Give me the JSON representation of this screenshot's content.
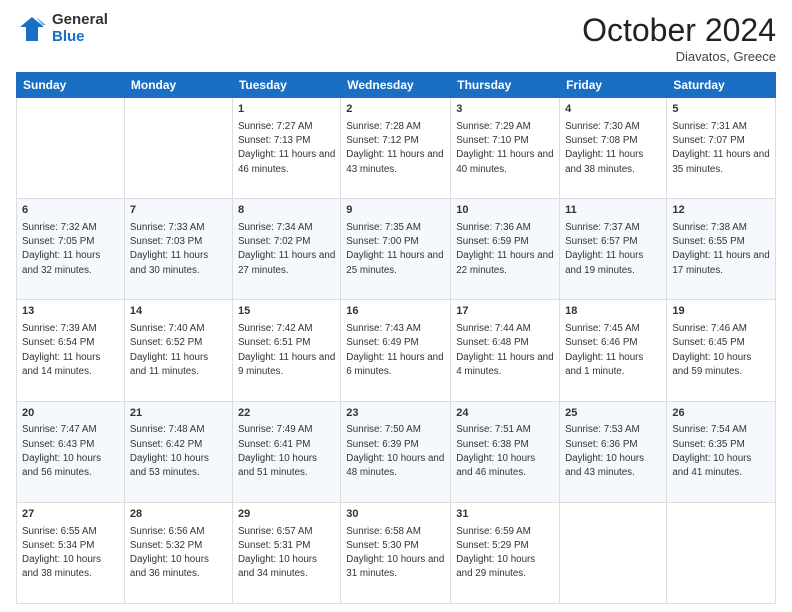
{
  "logo": {
    "general": "General",
    "blue": "Blue"
  },
  "header": {
    "month": "October 2024",
    "location": "Diavatos, Greece"
  },
  "weekdays": [
    "Sunday",
    "Monday",
    "Tuesday",
    "Wednesday",
    "Thursday",
    "Friday",
    "Saturday"
  ],
  "weeks": [
    [
      {
        "day": "",
        "info": ""
      },
      {
        "day": "",
        "info": ""
      },
      {
        "day": "1",
        "info": "Sunrise: 7:27 AM\nSunset: 7:13 PM\nDaylight: 11 hours and 46 minutes."
      },
      {
        "day": "2",
        "info": "Sunrise: 7:28 AM\nSunset: 7:12 PM\nDaylight: 11 hours and 43 minutes."
      },
      {
        "day": "3",
        "info": "Sunrise: 7:29 AM\nSunset: 7:10 PM\nDaylight: 11 hours and 40 minutes."
      },
      {
        "day": "4",
        "info": "Sunrise: 7:30 AM\nSunset: 7:08 PM\nDaylight: 11 hours and 38 minutes."
      },
      {
        "day": "5",
        "info": "Sunrise: 7:31 AM\nSunset: 7:07 PM\nDaylight: 11 hours and 35 minutes."
      }
    ],
    [
      {
        "day": "6",
        "info": "Sunrise: 7:32 AM\nSunset: 7:05 PM\nDaylight: 11 hours and 32 minutes."
      },
      {
        "day": "7",
        "info": "Sunrise: 7:33 AM\nSunset: 7:03 PM\nDaylight: 11 hours and 30 minutes."
      },
      {
        "day": "8",
        "info": "Sunrise: 7:34 AM\nSunset: 7:02 PM\nDaylight: 11 hours and 27 minutes."
      },
      {
        "day": "9",
        "info": "Sunrise: 7:35 AM\nSunset: 7:00 PM\nDaylight: 11 hours and 25 minutes."
      },
      {
        "day": "10",
        "info": "Sunrise: 7:36 AM\nSunset: 6:59 PM\nDaylight: 11 hours and 22 minutes."
      },
      {
        "day": "11",
        "info": "Sunrise: 7:37 AM\nSunset: 6:57 PM\nDaylight: 11 hours and 19 minutes."
      },
      {
        "day": "12",
        "info": "Sunrise: 7:38 AM\nSunset: 6:55 PM\nDaylight: 11 hours and 17 minutes."
      }
    ],
    [
      {
        "day": "13",
        "info": "Sunrise: 7:39 AM\nSunset: 6:54 PM\nDaylight: 11 hours and 14 minutes."
      },
      {
        "day": "14",
        "info": "Sunrise: 7:40 AM\nSunset: 6:52 PM\nDaylight: 11 hours and 11 minutes."
      },
      {
        "day": "15",
        "info": "Sunrise: 7:42 AM\nSunset: 6:51 PM\nDaylight: 11 hours and 9 minutes."
      },
      {
        "day": "16",
        "info": "Sunrise: 7:43 AM\nSunset: 6:49 PM\nDaylight: 11 hours and 6 minutes."
      },
      {
        "day": "17",
        "info": "Sunrise: 7:44 AM\nSunset: 6:48 PM\nDaylight: 11 hours and 4 minutes."
      },
      {
        "day": "18",
        "info": "Sunrise: 7:45 AM\nSunset: 6:46 PM\nDaylight: 11 hours and 1 minute."
      },
      {
        "day": "19",
        "info": "Sunrise: 7:46 AM\nSunset: 6:45 PM\nDaylight: 10 hours and 59 minutes."
      }
    ],
    [
      {
        "day": "20",
        "info": "Sunrise: 7:47 AM\nSunset: 6:43 PM\nDaylight: 10 hours and 56 minutes."
      },
      {
        "day": "21",
        "info": "Sunrise: 7:48 AM\nSunset: 6:42 PM\nDaylight: 10 hours and 53 minutes."
      },
      {
        "day": "22",
        "info": "Sunrise: 7:49 AM\nSunset: 6:41 PM\nDaylight: 10 hours and 51 minutes."
      },
      {
        "day": "23",
        "info": "Sunrise: 7:50 AM\nSunset: 6:39 PM\nDaylight: 10 hours and 48 minutes."
      },
      {
        "day": "24",
        "info": "Sunrise: 7:51 AM\nSunset: 6:38 PM\nDaylight: 10 hours and 46 minutes."
      },
      {
        "day": "25",
        "info": "Sunrise: 7:53 AM\nSunset: 6:36 PM\nDaylight: 10 hours and 43 minutes."
      },
      {
        "day": "26",
        "info": "Sunrise: 7:54 AM\nSunset: 6:35 PM\nDaylight: 10 hours and 41 minutes."
      }
    ],
    [
      {
        "day": "27",
        "info": "Sunrise: 6:55 AM\nSunset: 5:34 PM\nDaylight: 10 hours and 38 minutes."
      },
      {
        "day": "28",
        "info": "Sunrise: 6:56 AM\nSunset: 5:32 PM\nDaylight: 10 hours and 36 minutes."
      },
      {
        "day": "29",
        "info": "Sunrise: 6:57 AM\nSunset: 5:31 PM\nDaylight: 10 hours and 34 minutes."
      },
      {
        "day": "30",
        "info": "Sunrise: 6:58 AM\nSunset: 5:30 PM\nDaylight: 10 hours and 31 minutes."
      },
      {
        "day": "31",
        "info": "Sunrise: 6:59 AM\nSunset: 5:29 PM\nDaylight: 10 hours and 29 minutes."
      },
      {
        "day": "",
        "info": ""
      },
      {
        "day": "",
        "info": ""
      }
    ]
  ]
}
